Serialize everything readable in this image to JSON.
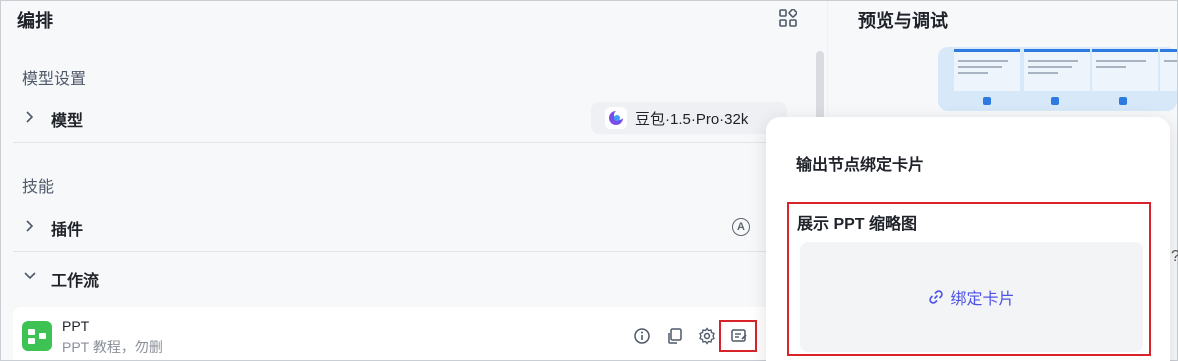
{
  "left": {
    "title": "编排",
    "sections": {
      "model_settings": "模型设置",
      "model_row": "模型",
      "model_value": "豆包·1.5·Pro·32k",
      "skills": "技能",
      "plugins_row": "插件",
      "plugins_badge": "A",
      "workflow_row": "工作流"
    },
    "workflow_item": {
      "name": "PPT",
      "description": "PPT 教程，勿删"
    }
  },
  "right": {
    "title": "预览与调试",
    "stray_glyph": "?"
  },
  "popover": {
    "title": "输出节点绑定卡片",
    "subtitle": "展示 PPT 缩略图",
    "bind_label": "绑定卡片"
  },
  "colors": {
    "accent": "#4d53e8",
    "highlight": "#d9232a",
    "workflow_icon": "#3ec254",
    "preview_blue": "#2d7be0"
  },
  "icons": [
    "grid-icon",
    "chevron-right-icon",
    "chevron-down-icon",
    "info-icon",
    "copy-icon",
    "gear-icon",
    "edit-card-icon",
    "link-icon"
  ]
}
